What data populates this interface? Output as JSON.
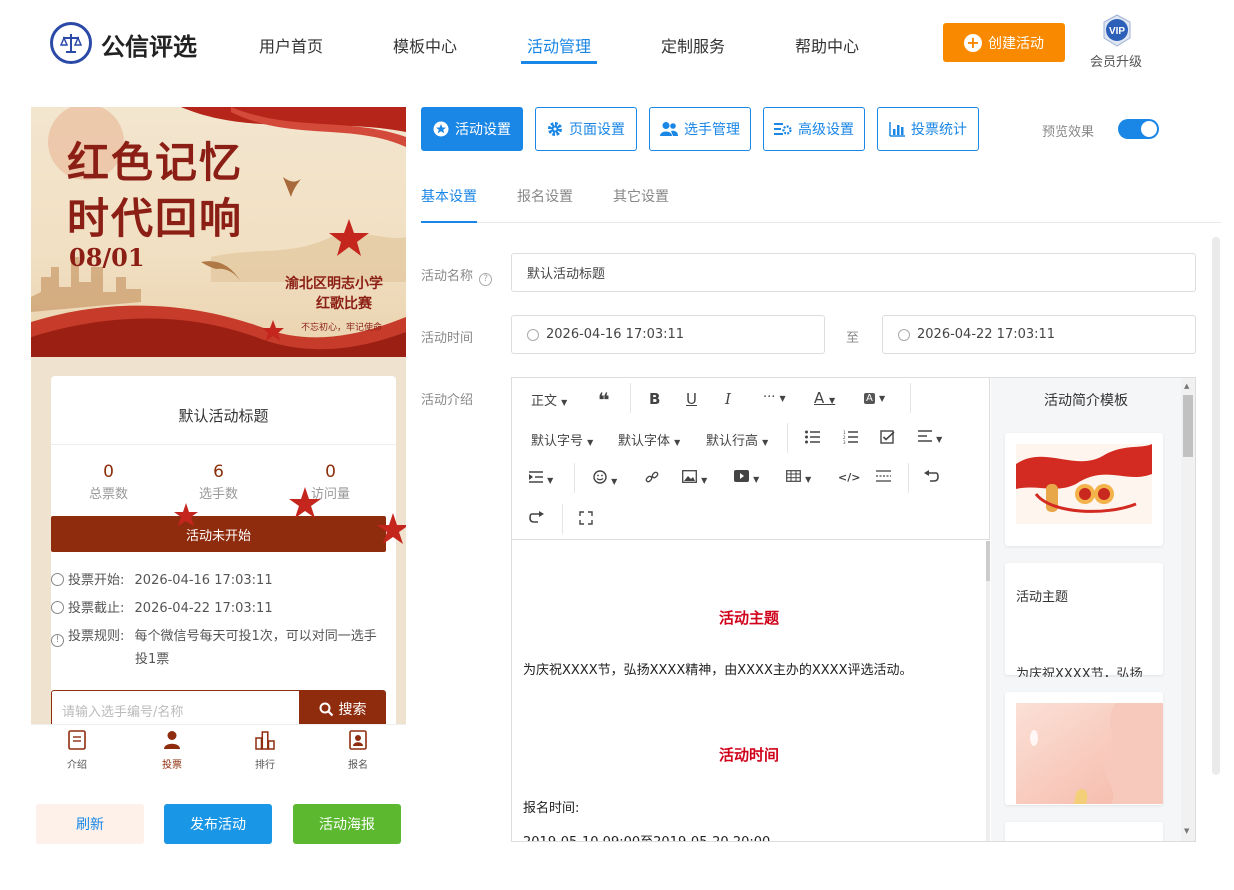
{
  "header": {
    "brand": "公信评选",
    "nav": [
      "用户首页",
      "模板中心",
      "活动管理",
      "定制服务",
      "帮助中心"
    ],
    "active_nav": "活动管理",
    "create_button": "创建活动",
    "vip_badge": "VIP",
    "vip_label": "会员升级"
  },
  "poster": {
    "title_line1": "红色记忆",
    "title_line2": "时代回响",
    "date": "08/01",
    "subtitle_line1": "渝北区明志小学",
    "subtitle_line2": "红歌比赛",
    "slogan": "不忘初心，牢记使命"
  },
  "preview": {
    "activity_title": "默认活动标题",
    "stats": [
      {
        "value": "0",
        "label": "总票数"
      },
      {
        "value": "6",
        "label": "选手数"
      },
      {
        "value": "0",
        "label": "访问量"
      }
    ],
    "status": "活动未开始",
    "vote_start_label": "投票开始:",
    "vote_start": "2026-04-16 17:03:11",
    "vote_end_label": "投票截止:",
    "vote_end": "2026-04-22 17:03:11",
    "rules_label": "投票规则:",
    "rules_line1": "每个微信号每天可投1次，可以对同一选手",
    "rules_line2": "投1票",
    "search_placeholder": "请输入选手编号/名称",
    "search_button": "搜索",
    "tabs": [
      "介绍",
      "投票",
      "排行",
      "报名"
    ]
  },
  "bottom_buttons": {
    "refresh": "刷新",
    "publish": "发布活动",
    "poster": "活动海报"
  },
  "settings_tabs": [
    "活动设置",
    "页面设置",
    "选手管理",
    "高级设置",
    "投票统计"
  ],
  "preview_toggle": {
    "label": "预览效果",
    "on": true
  },
  "sub_tabs": [
    "基本设置",
    "报名设置",
    "其它设置"
  ],
  "form": {
    "name_label": "活动名称",
    "name_value": "默认活动标题",
    "time_label": "活动时间",
    "time_start": "2026-04-16 17:03:11",
    "time_sep": "至",
    "time_end": "2026-04-22 17:03:11",
    "intro_label": "活动介绍"
  },
  "editor": {
    "toolbar": {
      "paragraph": "正文",
      "font_size": "默认字号",
      "font_family": "默认字体",
      "line_height": "默认行高"
    },
    "content": {
      "heading1": "活动主题",
      "para1": "为庆祝XXXX节，弘扬XXXX精神，由XXXX主办的XXXX评选活动。",
      "heading2": "活动时间",
      "para2": "报名时间:",
      "para3": "2019-05-10 09:00至2019-05-20 20:00"
    },
    "template_panel": {
      "title": "活动简介模板",
      "card2_title": "活动主题",
      "card2_text": "为庆祝XXXX节，弘扬"
    }
  },
  "colors": {
    "primary": "#1a86e6",
    "orange": "#f98a00",
    "maroon": "#8f2c0e",
    "green": "#5bb82f",
    "red_heading": "#d0021b"
  }
}
